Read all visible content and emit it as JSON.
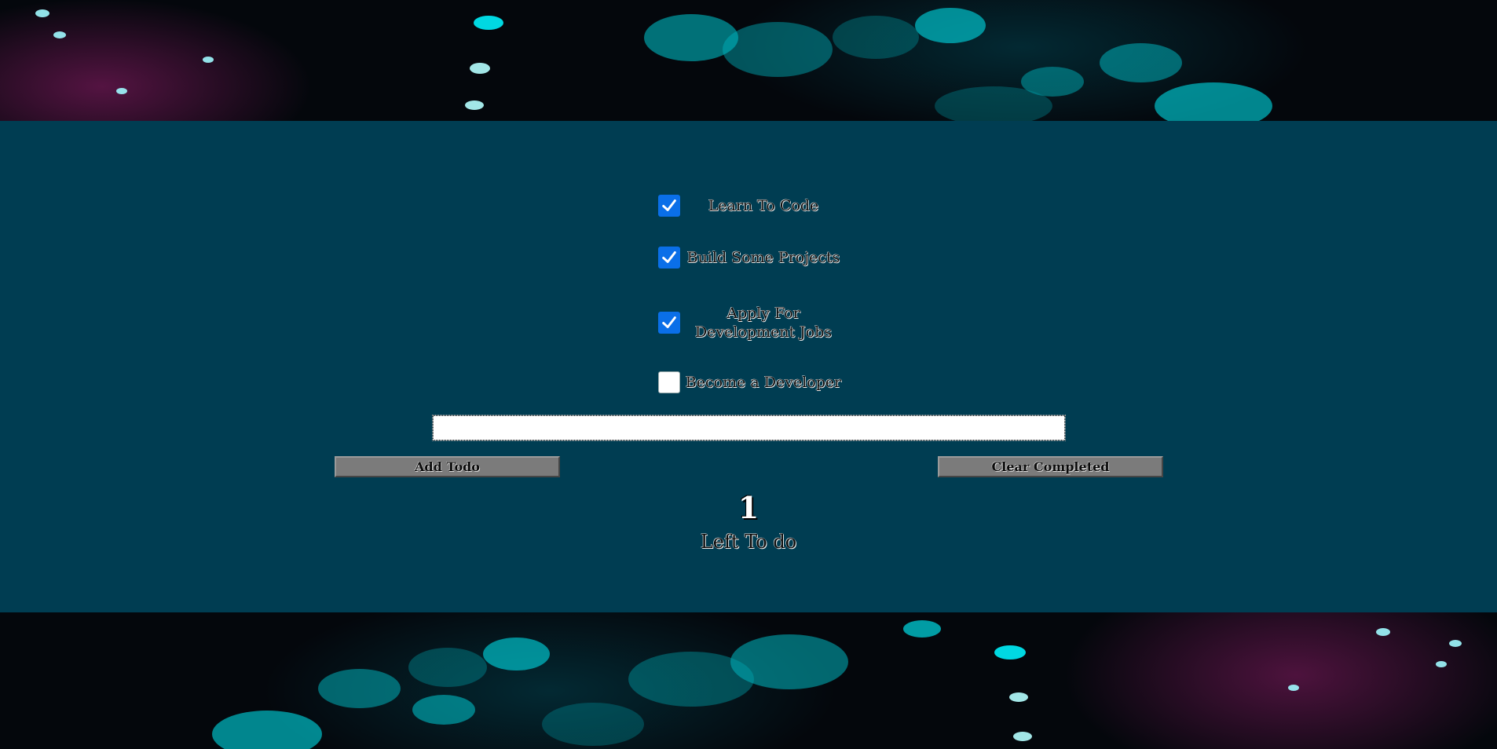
{
  "todos": [
    {
      "label": "Learn To Code",
      "checked": true
    },
    {
      "label": "Build Some Projects",
      "checked": true
    },
    {
      "label": "Apply For Development Jobs",
      "checked": true
    },
    {
      "label": "Become a Developer",
      "checked": false
    }
  ],
  "input": {
    "value": "",
    "placeholder": ""
  },
  "buttons": {
    "add_label": "Add Todo",
    "clear_label": "Clear Completed"
  },
  "counter": {
    "count": "1",
    "label": "Left To do"
  },
  "colors": {
    "panel": "#003d52",
    "checkbox_checked": "#0a6fe8",
    "button": "#7b7b7b"
  }
}
